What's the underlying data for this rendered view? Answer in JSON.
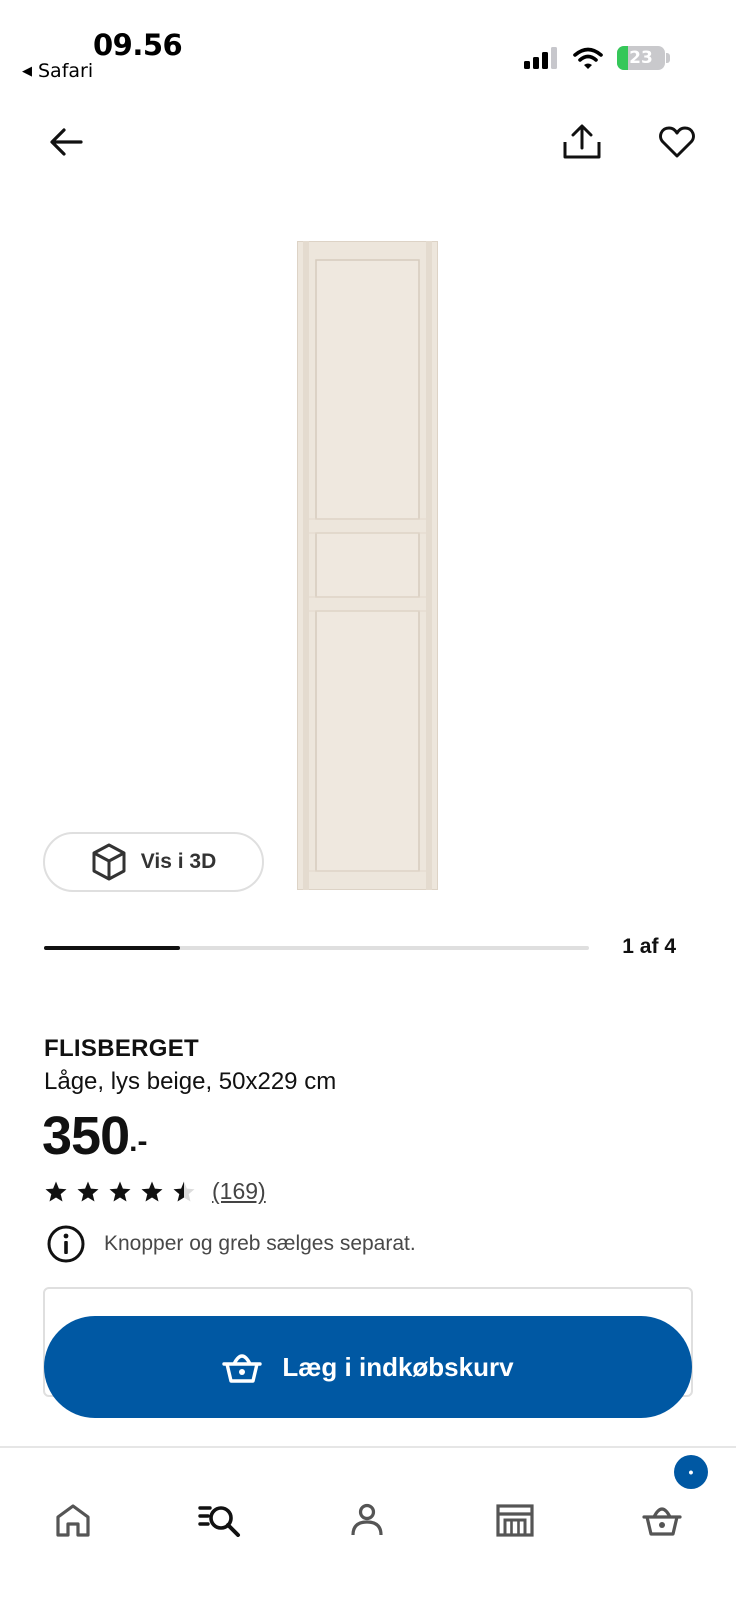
{
  "status_bar": {
    "time": "09.56",
    "back_app": "Safari",
    "battery_percent": 23,
    "battery_label": "23",
    "battery_color": "#35c759",
    "icons": [
      "signal-icon",
      "wifi-icon",
      "battery-charging-icon"
    ]
  },
  "header": {
    "icons": [
      "arrow-left-icon",
      "share-icon",
      "heart-icon"
    ]
  },
  "gallery": {
    "view_3d_label": "Vis i 3D",
    "page_indicator": "1 af 4",
    "current_index": 1,
    "total": 4,
    "progress_fraction": 0.25
  },
  "product": {
    "name": "FLISBERGET",
    "description": "Låge, lys beige, 50x229 cm",
    "price": "350",
    "price_suffix": ".-",
    "rating": 4.5,
    "max_rating": 5,
    "review_count": "(169)",
    "notice": "Knopper og greb sælges separat.",
    "door_color": "#eae2d8"
  },
  "cta": {
    "label": "Læg i indkøbskurv",
    "color": "#0058a3"
  },
  "bottom_nav": {
    "items": [
      {
        "name": "home",
        "icon": "home-icon"
      },
      {
        "name": "search",
        "icon": "search-list-icon",
        "active": true
      },
      {
        "name": "profile",
        "icon": "person-icon"
      },
      {
        "name": "store",
        "icon": "store-icon"
      },
      {
        "name": "cart",
        "icon": "basket-icon"
      }
    ],
    "cart_badge": "•"
  }
}
